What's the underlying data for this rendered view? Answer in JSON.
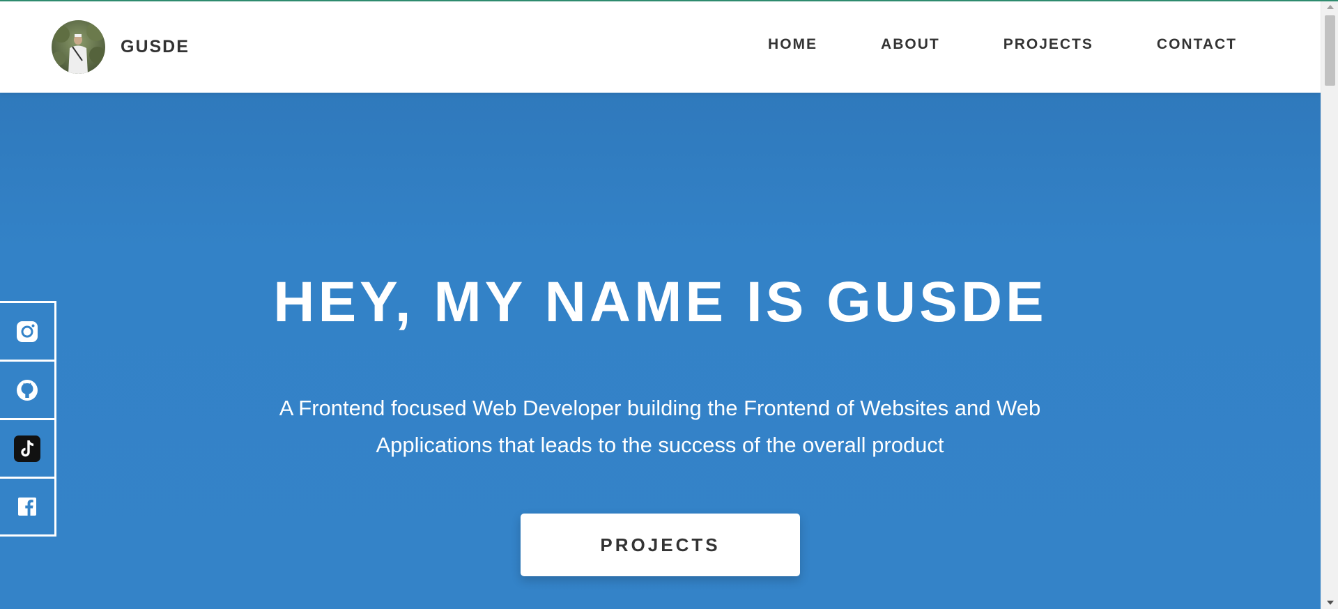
{
  "header": {
    "brand_name": "GUSDE",
    "nav": [
      {
        "label": "HOME"
      },
      {
        "label": "ABOUT"
      },
      {
        "label": "PROJECTS"
      },
      {
        "label": "CONTACT"
      }
    ]
  },
  "hero": {
    "title": "HEY, MY NAME IS GUSDE",
    "subtitle": "A Frontend focused Web Developer building the Frontend of Websites and Web Applications that leads to the success of the overall product",
    "cta_label": "PROJECTS"
  },
  "social": [
    {
      "icon": "instagram-icon"
    },
    {
      "icon": "github-icon"
    },
    {
      "icon": "tiktok-icon"
    },
    {
      "icon": "facebook-icon"
    }
  ],
  "colors": {
    "hero_bg": "#3483c8",
    "text_dark": "#333333",
    "accent_line": "#2e8b6e"
  }
}
